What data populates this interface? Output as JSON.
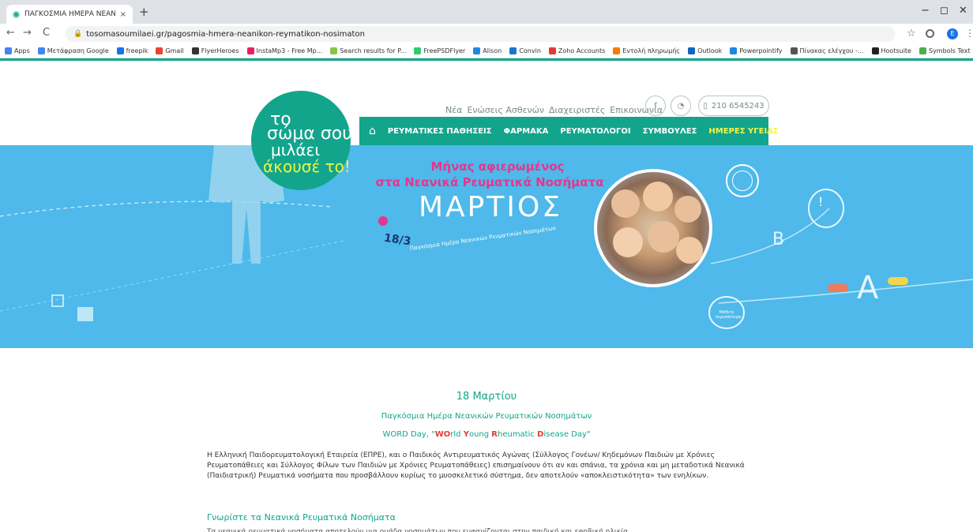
{
  "browser": {
    "tab_title": "ΠΑΓΚΟΣΜΙΑ ΗΜΕΡΑ ΝΕΑΝΙΚΩΝ",
    "tab_close": "×",
    "new_tab": "+",
    "url": "tosomasoumilaei.gr/pagosmia-hmera-neanikon-reymatikon-nosimaton",
    "win_min": "−",
    "win_max": "◻",
    "win_close": "✕",
    "profile_letter": "E",
    "bookmarks": [
      {
        "label": "Apps",
        "color": "#4285f4"
      },
      {
        "label": "Μετάφραση Google",
        "color": "#4285f4"
      },
      {
        "label": "freepik",
        "color": "#1273eb"
      },
      {
        "label": "Gmail",
        "color": "#ea4335"
      },
      {
        "label": "FlyerHeroes",
        "color": "#333333"
      },
      {
        "label": "InstaMp3 - Free Mp...",
        "color": "#e91e63"
      },
      {
        "label": "Search results for P...",
        "color": "#8bc34a"
      },
      {
        "label": "FreePSDFlyer",
        "color": "#2ecc71"
      },
      {
        "label": "Alison",
        "color": "#1e88e5"
      },
      {
        "label": "Convin",
        "color": "#1976d2"
      },
      {
        "label": "Zoho Accounts",
        "color": "#e53935"
      },
      {
        "label": "Εντολή πληρωμής",
        "color": "#f57c00"
      },
      {
        "label": "Outlook",
        "color": "#1565c0"
      },
      {
        "label": "Powerpointify",
        "color": "#1e88e5"
      },
      {
        "label": "Πίνακας ελέγχου -...",
        "color": "#555555"
      },
      {
        "label": "Hootsuite",
        "color": "#222222"
      },
      {
        "label": "Symbols Text",
        "color": "#4caf50"
      }
    ]
  },
  "header": {
    "top_links": [
      "Νέα",
      "Ενώσεις Ασθενών",
      "Διαχειριστές",
      "Επικοινωνία"
    ],
    "phone": "210 6545243",
    "main_nav": [
      {
        "label": "ΡΕΥΜΑΤΙΚΕΣ ΠΑΘΗΣΕΙΣ",
        "active": false
      },
      {
        "label": "ΦΑΡΜΑΚΑ",
        "active": false
      },
      {
        "label": "ΡΕΥΜΑΤΟΛΟΓΟΙ",
        "active": false
      },
      {
        "label": "ΣΥΜΒΟΥΛΕΣ",
        "active": false
      },
      {
        "label": "ΗΜΕΡΕΣ ΥΓΕΙΑΣ",
        "active": true
      }
    ]
  },
  "logo": {
    "line1": "το",
    "line2": "σώμα σου",
    "line3": "μιλάει",
    "line4": "άκουσέ το!"
  },
  "hero": {
    "title_line1": "Μήνας αφιερωμένος",
    "title_line2": "στα Νεανικά Ρευματικά Νοσήματα",
    "month": "ΜΑΡΤΙΟΣ",
    "date": "18/3",
    "caption": "Παγκόσμια Ημέρα Νεανικών Ρευματικών Νοσημάτων",
    "bubble": "Μάθετε περισσότερα",
    "letter_b": "B",
    "letter_a": "A",
    "exclaim": "!"
  },
  "content": {
    "title": "18 Μαρτίου",
    "subtitle": "Παγκόσμια Ημέρα Νεανικών Ρευματικών Νοσημάτων",
    "word_prefix": "WORD Day, \"",
    "word_r1": "WO",
    "word_t1": "rld ",
    "word_r2": "Y",
    "word_t2": "oung ",
    "word_r3": "R",
    "word_t3": "heumatic ",
    "word_r4": "D",
    "word_t4": "isease Day\"",
    "paragraph": "Η Ελληνική Παιδορευματολογική Εταιρεία (ΕΠΡΕ), και ο Παιδικός Αντιρευματικός Αγώνας (Σύλλογος Γονέων/ Κηδεμόνων Παιδιών με Χρόνιες Ρευματοπάθειες και Σύλλογος Φίλων των Παιδιών με Χρόνιες Ρευματοπάθειες) επισημαίνουν ότι αν και σπάνια, τα χρόνια και μη μεταδοτικά Νεανικά (Παιδιατρική) Ρευματικά νοσήματα που προσβάλλουν κυρίως το μυοσκελετικό σύστημα, δεν αποτελούν «αποκλειστικότητα» των ενηλίκων.",
    "section_heading": "Γνωρίστε τα Νεανικά Ρευματικά Νοσήματα",
    "cut_line": "Τα νεανικά ρευματικά νοσήματα αποτελούν μια ομάδα νοσημάτων που εμφανίζονται στην παιδική και εφηβική ηλικία"
  },
  "colors": {
    "brand_teal": "#12a58c",
    "hero_blue": "#4eb9ea",
    "accent_pink": "#e8348e",
    "active_nav": "#f1f54a"
  }
}
